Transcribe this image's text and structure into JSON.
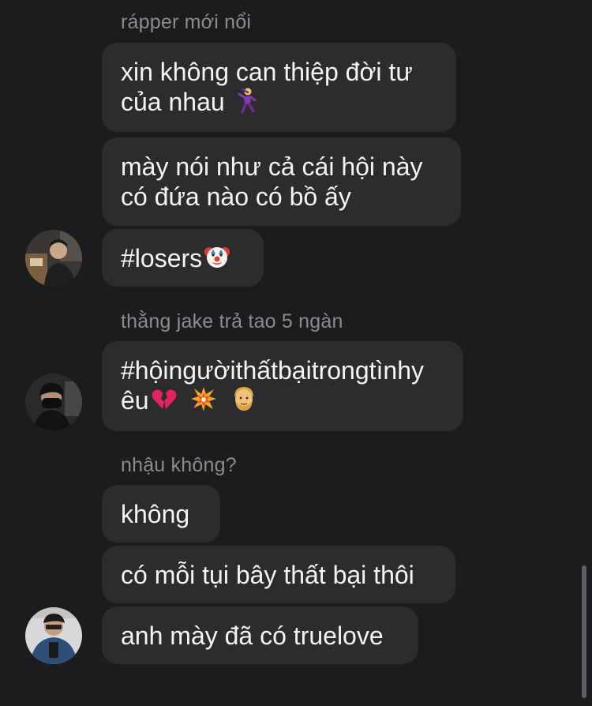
{
  "thread": {
    "groups": [
      {
        "sender": "rápper mới nổi",
        "messages": [
          {
            "lines": [
              "xin không can thiệp đời tư",
              "của nhau"
            ],
            "emoji_icon": "man-dancing-icon"
          },
          {
            "lines": [
              "mày nói như cả cái hội này",
              "có đứa nào có bồ ấy"
            ]
          },
          {
            "lines": [
              "#losers"
            ],
            "emoji_icon": "clown-face-icon"
          }
        ]
      },
      {
        "sender": "thằng jake trả tao 5 ngàn",
        "messages": [
          {
            "lines": [
              "#hộingườithấtbạitrongtìnhy",
              "êu"
            ],
            "emoji_icons": [
              "broken-heart-icon",
              "collision-icon",
              "bearded-person-icon"
            ]
          }
        ]
      },
      {
        "sender": "nhậu không?",
        "messages": [
          {
            "lines": [
              "không"
            ]
          },
          {
            "lines": [
              "có mỗi tụi bây thất bại thôi"
            ]
          },
          {
            "lines": [
              "anh mày đã có truelove"
            ]
          }
        ]
      }
    ]
  },
  "colors": {
    "background": "#1c1c1e",
    "bubble": "#2c2c2e",
    "sender_name": "#8b8b90",
    "text": "#f4f4f4"
  }
}
